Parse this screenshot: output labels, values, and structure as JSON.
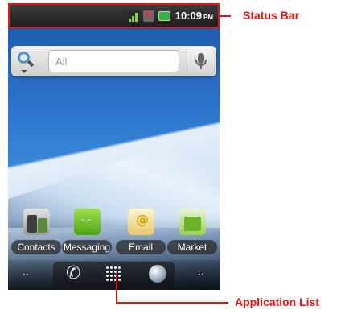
{
  "status_bar": {
    "time": "10:09",
    "ampm": "PM",
    "icons": [
      "signal-icon",
      "no-sim-icon",
      "battery-icon"
    ]
  },
  "search": {
    "placeholder": "All",
    "icons": [
      "search-icon",
      "mic-icon"
    ]
  },
  "home_apps": [
    {
      "label": "Contacts",
      "icon": "contacts-icon"
    },
    {
      "label": "Messaging",
      "icon": "messaging-icon"
    },
    {
      "label": "Email",
      "icon": "email-icon"
    },
    {
      "label": "Market",
      "icon": "market-icon"
    }
  ],
  "dock": {
    "icons": [
      "phone-icon",
      "app-grid-icon",
      "browser-icon"
    ],
    "left_dots": "··",
    "right_dots": "··"
  },
  "annotations": {
    "status_bar_label": "Status Bar",
    "application_list_label": "Application List",
    "color": "#e01515"
  }
}
